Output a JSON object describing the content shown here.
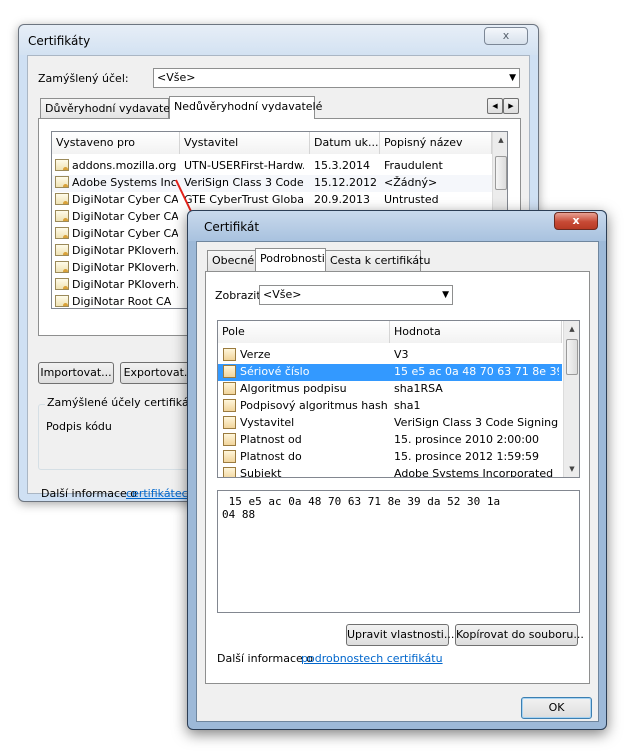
{
  "back_window": {
    "title": "Certifikáty",
    "close_label": "x",
    "purpose_label": "Zamýšlený účel:",
    "purpose_value": "<Vše>",
    "tabs": [
      "Důvěryhodní vydavatelé",
      "Nedůvěryhodní vydavatelé"
    ],
    "columns": [
      "Vystaveno pro",
      "Vystavitel",
      "Datum uk...",
      "Popisný název"
    ],
    "rows": [
      [
        "addons.mozilla.org",
        "UTN-USERFirst-Hardw...",
        "15.3.2014",
        "Fraudulent"
      ],
      [
        "Adobe Systems Inc...",
        "VeriSign Class 3 Code ...",
        "15.12.2012",
        "<Žádný>"
      ],
      [
        "DigiNotar Cyber CA",
        "GTE CyberTrust Globa...",
        "20.9.2013",
        "Untrusted"
      ],
      [
        "DigiNotar Cyber CA",
        "",
        "",
        ""
      ],
      [
        "DigiNotar Cyber CA",
        "",
        "",
        ""
      ],
      [
        "DigiNotar PKIoverh...",
        "",
        "",
        ""
      ],
      [
        "DigiNotar PKIoverh...",
        "",
        "",
        ""
      ],
      [
        "DigiNotar PKIoverh...",
        "",
        "",
        ""
      ],
      [
        "DigiNotar Root CA",
        "",
        "",
        ""
      ]
    ],
    "import_button": "Importovat...",
    "export_button": "Exportovat...",
    "group_title": "Zamýšlené účely certifikátu",
    "group_value": "Podpis kódu",
    "more_info_prefix": "Další informace o ",
    "more_info_link": "certifikátech"
  },
  "front_window": {
    "title": "Certifikát",
    "tabs": [
      "Obecné",
      "Podrobnosti",
      "Cesta k certifikátu"
    ],
    "show_label": "Zobrazit:",
    "show_value": "<Vše>",
    "columns": [
      "Pole",
      "Hodnota"
    ],
    "fields": [
      [
        "Verze",
        "V3"
      ],
      [
        "Sériové číslo",
        "15 e5 ac 0a 48 70 63 71 8e 39..."
      ],
      [
        "Algoritmus podpisu",
        "sha1RSA"
      ],
      [
        "Podpisový algoritmus hash",
        "sha1"
      ],
      [
        "Vystavitel",
        "VeriSign Class 3 Code Signing ..."
      ],
      [
        "Platnost od",
        "15. prosince 2010 2:00:00"
      ],
      [
        "Platnost do",
        "15. prosince 2012 1:59:59"
      ],
      [
        "Subjekt",
        "Adobe Systems Incorporated"
      ]
    ],
    "detail_text": " 15 e5 ac 0a 48 70 63 71 8e 39 da 52 30 1a\n04 88",
    "edit_button": "Upravit vlastnosti...",
    "copy_button": "Kopírovat do souboru...",
    "more_info_prefix": "Další informace o ",
    "more_info_link": "podrobnostech certifikátu",
    "ok_button": "OK",
    "close_label": "x"
  },
  "colors": {
    "selection": "#3399ff",
    "link": "#0066cc",
    "arrow": "#e32119"
  }
}
